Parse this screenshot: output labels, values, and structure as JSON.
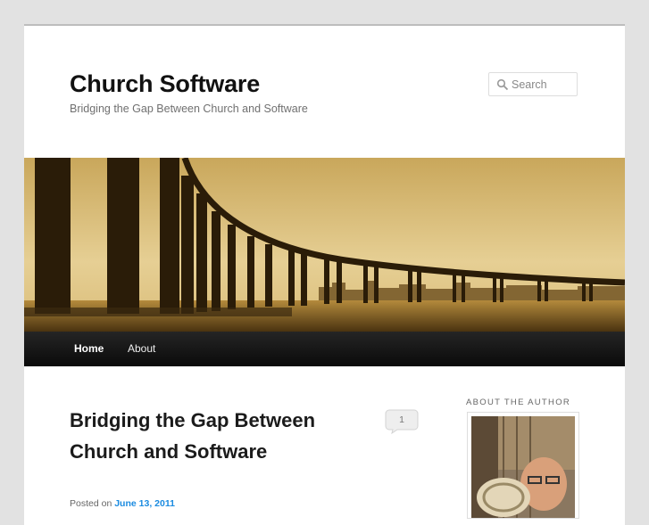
{
  "site": {
    "title": "Church Software",
    "description": "Bridging the Gap Between Church and Software"
  },
  "search": {
    "placeholder": "Search"
  },
  "nav": {
    "items": [
      {
        "label": "Home"
      },
      {
        "label": "About"
      }
    ]
  },
  "post": {
    "title": "Bridging the Gap Between Church and Software",
    "comment_count": "1",
    "posted_prefix": "Posted on",
    "date": "June 13, 2011"
  },
  "sidebar": {
    "widget_title": "About the Author"
  },
  "icons": {
    "search": "search-icon",
    "comment": "comment-bubble-icon"
  },
  "colors": {
    "link": "#1b8be0",
    "nav_bg": "#111111",
    "page_bg": "#e2e2e2"
  }
}
